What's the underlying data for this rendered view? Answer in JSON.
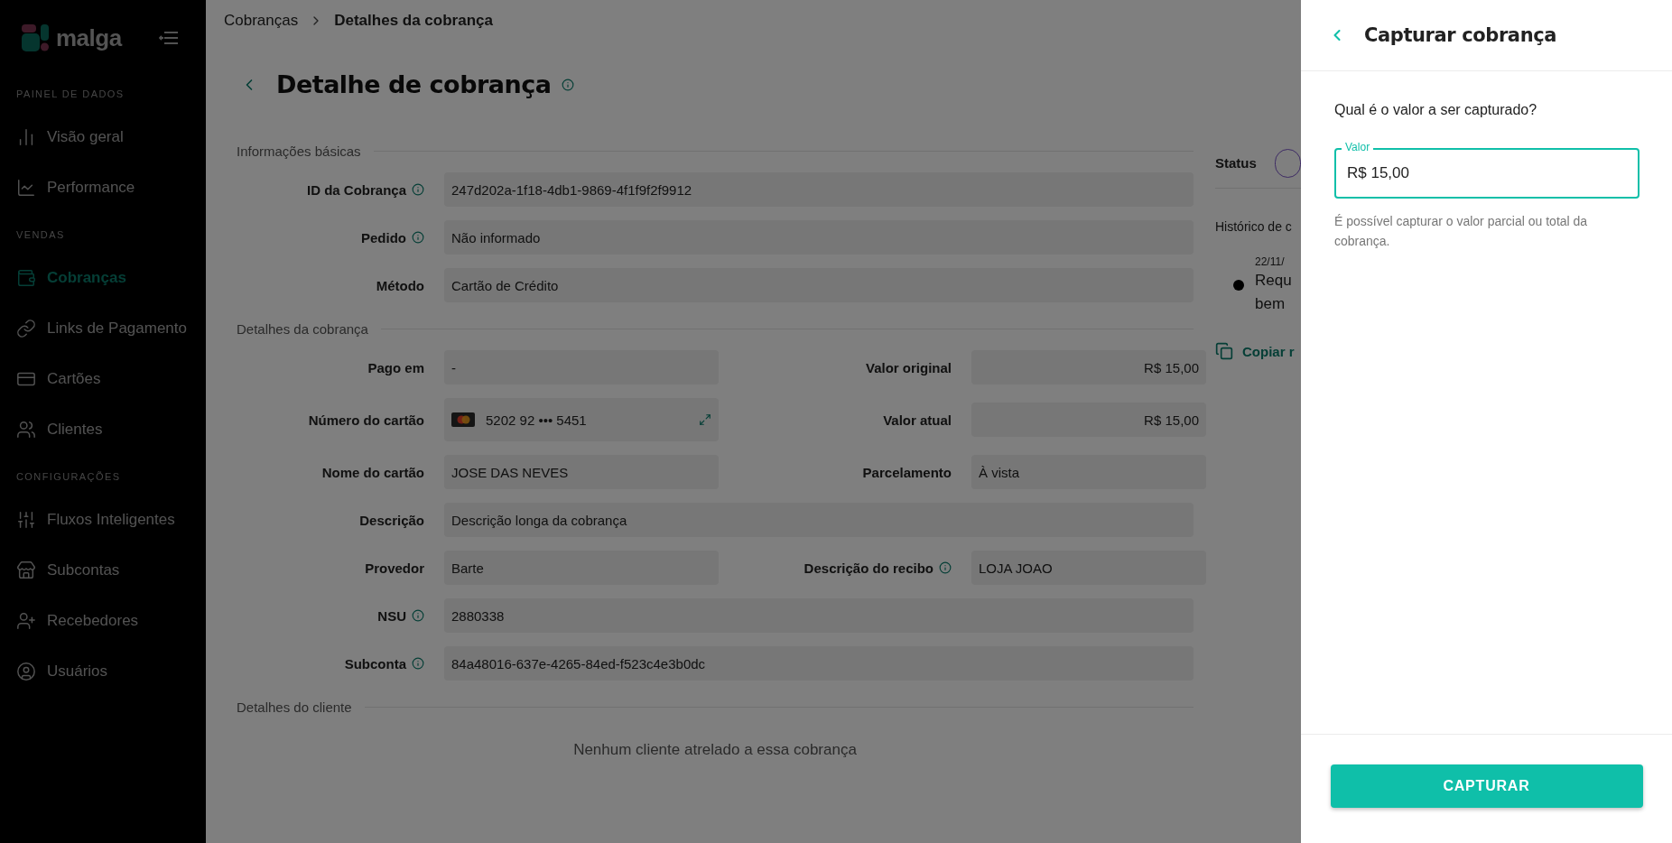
{
  "sidebar": {
    "brand": "malga",
    "groups": [
      {
        "title": "PAINEL DE DADOS",
        "items": [
          {
            "label": "Visão geral",
            "selected": false
          },
          {
            "label": "Performance",
            "selected": false
          }
        ]
      },
      {
        "title": "VENDAS",
        "items": [
          {
            "label": "Cobranças",
            "selected": true
          },
          {
            "label": "Links de Pagamento",
            "selected": false
          },
          {
            "label": "Cartões",
            "selected": false
          },
          {
            "label": "Clientes",
            "selected": false
          }
        ]
      },
      {
        "title": "CONFIGURAÇÕES",
        "items": [
          {
            "label": "Fluxos Inteligentes",
            "selected": false
          },
          {
            "label": "Subcontas",
            "selected": false
          },
          {
            "label": "Recebedores",
            "selected": false
          },
          {
            "label": "Usuários",
            "selected": false
          }
        ]
      }
    ]
  },
  "breadcrumb": [
    {
      "label": "Cobranças",
      "current": false
    },
    {
      "label": "Detalhes da cobrança",
      "current": true
    }
  ],
  "page_title": "Detalhe de cobrança",
  "sections": [
    {
      "title": "Informações básicas",
      "rows": [
        [
          {
            "label": "ID da Cobrança",
            "info": true,
            "kind": "text",
            "value": "247d202a-1f18-4db1-9869-4f1f9f2f9912"
          }
        ],
        [
          {
            "label": "Pedido",
            "info": true,
            "kind": "text",
            "value": "Não informado"
          }
        ],
        [
          {
            "label": "Método",
            "info": false,
            "kind": "text",
            "value": "Cartão de Crédito"
          }
        ]
      ]
    },
    {
      "title": "Detalhes da cobrança",
      "rows": [
        [
          {
            "label": "Pago em",
            "info": false,
            "kind": "text",
            "value": "-"
          },
          {
            "label": "Valor original",
            "info": false,
            "kind": "amount",
            "value": "R$ 15,00"
          }
        ],
        [
          {
            "label": "Número do cartão",
            "info": false,
            "kind": "card",
            "value": "5202 92 ••• 5451"
          },
          {
            "label": "Valor atual",
            "info": false,
            "kind": "amount",
            "value": "R$ 15,00"
          }
        ],
        [
          {
            "label": "Nome do cartão",
            "info": false,
            "kind": "text",
            "value": "JOSE DAS NEVES"
          },
          {
            "label": "Parcelamento",
            "info": false,
            "kind": "text",
            "value": "À vista"
          }
        ],
        [
          {
            "label": "Descrição",
            "info": false,
            "kind": "text",
            "value": "Descrição longa da cobrança"
          }
        ],
        [
          {
            "label": "Provedor",
            "info": false,
            "kind": "text",
            "value": "Barte"
          },
          {
            "label": "Descrição do recibo",
            "info": true,
            "kind": "text",
            "value": "LOJA JOAO"
          }
        ],
        [
          {
            "label": "NSU",
            "info": true,
            "kind": "text",
            "value": "2880338"
          }
        ],
        [
          {
            "label": "Subconta",
            "info": true,
            "kind": "text",
            "value": "84a48016-637e-4265-84ed-f523c4e3b0dc"
          }
        ]
      ]
    },
    {
      "title": "Detalhes do cliente",
      "empty": "Nenhum cliente atrelado a essa cobrança"
    }
  ],
  "side_panel": {
    "status_label": "Status",
    "history_title": "Histórico de c",
    "history": [
      {
        "date": "22/11/",
        "lines": [
          "Requ",
          "bem"
        ]
      }
    ],
    "copy_link": "Copiar r"
  },
  "drawer": {
    "title": "Capturar cobrança",
    "question": "Qual é o valor a ser capturado?",
    "field": {
      "label": "Valor",
      "value": "R$ 15,00",
      "focused": true
    },
    "helper": "É possível capturar o valor parcial ou total da cobrança.",
    "button": "CAPTURAR"
  }
}
